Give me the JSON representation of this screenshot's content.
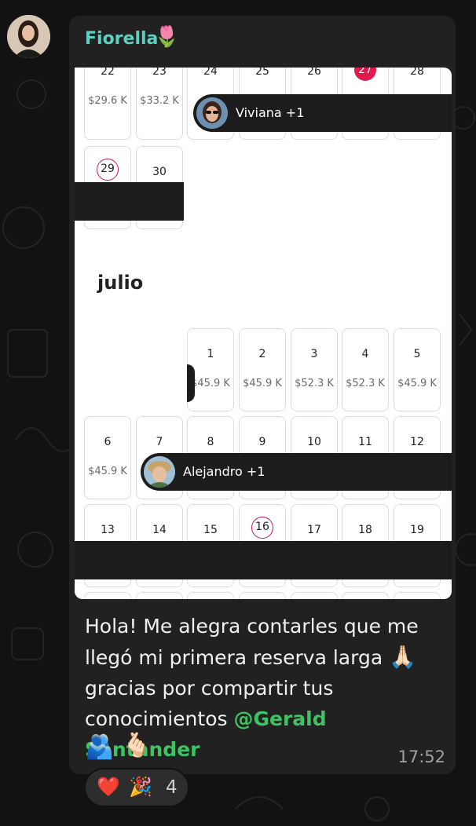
{
  "message": {
    "sender_name": "Fiorella",
    "sender_emoji": "🌷",
    "text_line1": "Hola! Me alegra contarles que me",
    "text_line2": "llegó mi primera reserva larga",
    "text_line3": "gracias por compartir tus",
    "text_line4": "conocimientos",
    "mention": "@Gerald Santander",
    "emoji_pray": "🙏🏻",
    "emoji_people": "🫂",
    "emoji_snap": "🫰🏻",
    "time": "17:52"
  },
  "reactions": {
    "heart": "❤️",
    "party": "🎉",
    "count": "4"
  },
  "calendar": {
    "june_row_a": [
      {
        "num": "22",
        "price": "$29.6 K"
      },
      {
        "num": "23",
        "price": "$33.2 K"
      },
      {
        "num": "24",
        "price": ""
      },
      {
        "num": "25",
        "price": ""
      },
      {
        "num": "26",
        "price": ""
      },
      {
        "num": "27",
        "price": ""
      },
      {
        "num": "28",
        "price": ""
      }
    ],
    "june_row_b": [
      {
        "num": "29",
        "price": ""
      },
      {
        "num": "30",
        "price": ""
      }
    ],
    "month_label": "julio",
    "july_row_1": [
      {
        "num": "1",
        "price": "$45.9 K"
      },
      {
        "num": "2",
        "price": "$45.9 K"
      },
      {
        "num": "3",
        "price": "$52.3 K"
      },
      {
        "num": "4",
        "price": "$52.3 K"
      },
      {
        "num": "5",
        "price": "$45.9 K"
      }
    ],
    "july_row_2": [
      {
        "num": "6",
        "price": "$45.9 K"
      },
      {
        "num": "7",
        "price": ""
      },
      {
        "num": "8",
        "price": ""
      },
      {
        "num": "9",
        "price": ""
      },
      {
        "num": "10",
        "price": ""
      },
      {
        "num": "11",
        "price": ""
      },
      {
        "num": "12",
        "price": ""
      }
    ],
    "july_row_3": [
      {
        "num": "13"
      },
      {
        "num": "14"
      },
      {
        "num": "15"
      },
      {
        "num": "16"
      },
      {
        "num": "17"
      },
      {
        "num": "18"
      },
      {
        "num": "19"
      }
    ],
    "guest_1": "Viviana +1",
    "guest_2": "Alejandro +1"
  },
  "colors": {
    "background": "#121212",
    "bubble": "#212121",
    "sender_name": "#5fd0c0",
    "mention": "#3fc264",
    "today_marker": "#e01a4f"
  }
}
